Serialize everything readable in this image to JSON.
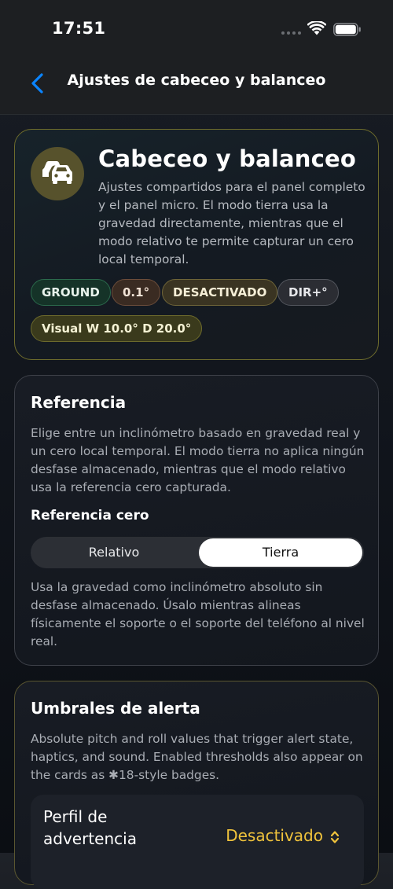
{
  "status_bar": {
    "time": "17:51"
  },
  "nav": {
    "title": "Ajustes de cabeceo y balanceo",
    "back_icon": "chevron-left-icon",
    "accent_color": "#0a84ff"
  },
  "hero": {
    "icon": "cars-icon",
    "title": "Cabeceo y balanceo",
    "description": "Ajustes compartidos para el panel completo y el panel micro. El modo tierra usa la gravedad directamente, mientras que el modo relativo te permite capturar un cero local temporal.",
    "badges": {
      "ground": "GROUND",
      "value": "0.1°",
      "status": "DESACTIVADO",
      "dir": "DIR+°",
      "visual": "Visual W 10.0°  D 20.0°"
    }
  },
  "reference": {
    "title": "Referencia",
    "description": "Elige entre un inclinómetro basado en gravedad real y un cero local temporal. El modo tierra no aplica ningún desfase almacenado, mientras que el modo relativo usa la referencia cero capturada.",
    "zero_label": "Referencia cero",
    "options": [
      "Relativo",
      "Tierra"
    ],
    "selected": "Tierra",
    "help": "Usa la gravedad como inclinómetro absoluto sin desfase almacenado. Úsalo mientras alineas físicamente el soporte o el soporte del teléfono al nivel real."
  },
  "alerts": {
    "title": "Umbrales de alerta",
    "description": "Absolute pitch and roll values that trigger alert state, haptics, and sound. Enabled thresholds also appear on the cards as ✱18-style badges.",
    "warning_profile_label": "Perfil de advertencia",
    "warning_profile_value": "Desactivado",
    "value_color": "#f0c33c"
  }
}
